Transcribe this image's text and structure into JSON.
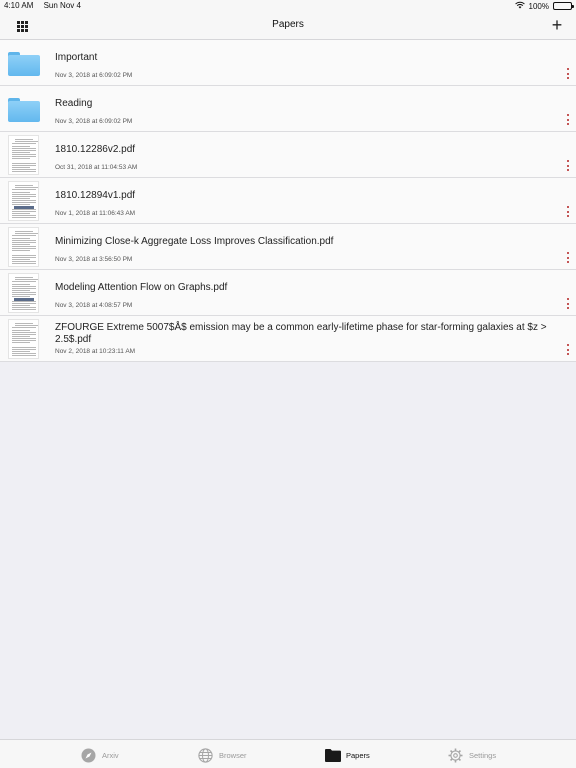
{
  "status": {
    "time": "4:10 AM",
    "date": "Sun Nov 4",
    "battery": "100%"
  },
  "nav": {
    "title": "Papers"
  },
  "items": [
    {
      "kind": "folder",
      "title": "Important",
      "date": "Nov 3, 2018 at 6:09:02 PM"
    },
    {
      "kind": "folder",
      "title": "Reading",
      "date": "Nov 3, 2018 at 6:09:02 PM"
    },
    {
      "kind": "pdf",
      "title": "1810.12286v2.pdf",
      "date": "Oct 31, 2018 at 11:04:53 AM"
    },
    {
      "kind": "pdf",
      "title": "1810.12894v1.pdf",
      "date": "Nov 1, 2018 at 11:06:43 AM"
    },
    {
      "kind": "pdf",
      "title": "Minimizing Close-k Aggregate Loss Improves Classification.pdf",
      "date": "Nov 3, 2018 at 3:56:50 PM"
    },
    {
      "kind": "pdf",
      "title": "Modeling Attention Flow on Graphs.pdf",
      "date": "Nov 3, 2018 at 4:08:57 PM"
    },
    {
      "kind": "pdf",
      "title": "ZFOURGE Extreme 5007$Å$ emission may be a common early-lifetime phase  for star-forming galaxies at $z > 2.5$.pdf",
      "date": "Nov 2, 2018 at 10:23:11 AM"
    }
  ],
  "tabs": [
    {
      "label": "Arxiv",
      "icon": "compass-icon",
      "active": false
    },
    {
      "label": "Browser",
      "icon": "globe-icon",
      "active": false
    },
    {
      "label": "Papers",
      "icon": "folder-icon",
      "active": true
    },
    {
      "label": "Settings",
      "icon": "gear-icon",
      "active": false
    }
  ],
  "colors": {
    "accent_dots": "#b22222",
    "folder": "#63b8ee",
    "bar": "#f7f7f7"
  }
}
